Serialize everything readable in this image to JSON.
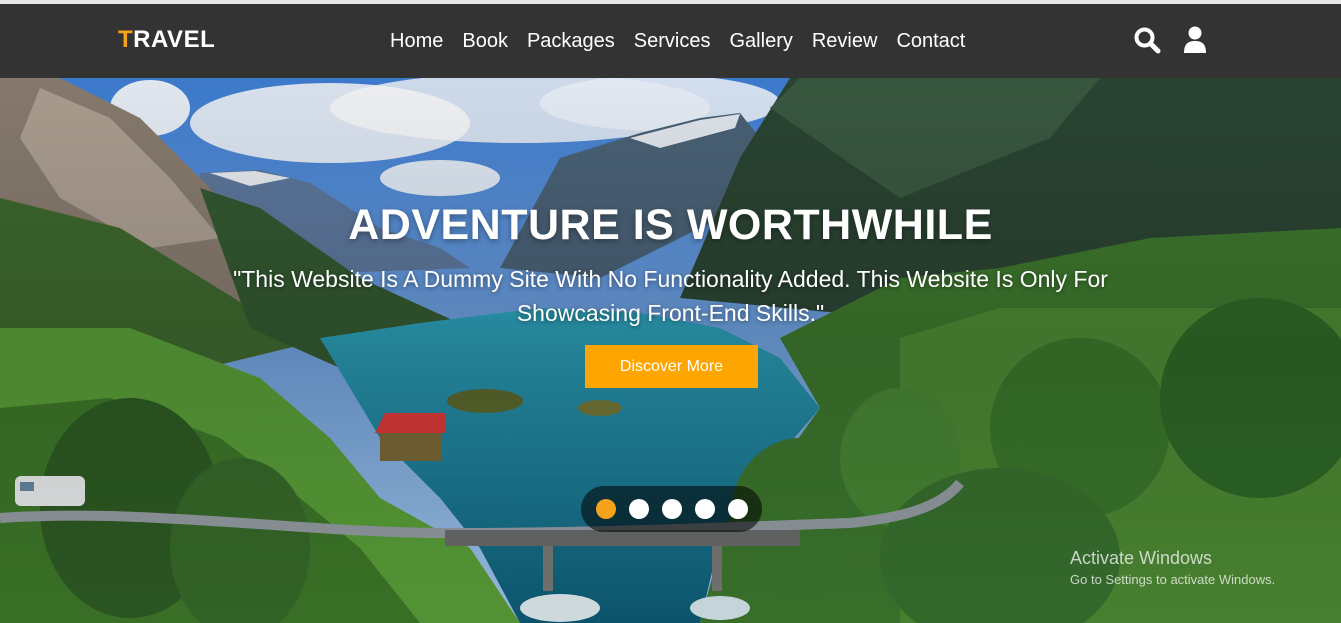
{
  "brand": {
    "initial": "T",
    "rest": "RAVEL",
    "accent_color": "#f7a21b"
  },
  "nav": {
    "links": [
      "Home",
      "Book",
      "Packages",
      "Services",
      "Gallery",
      "Review",
      "Contact"
    ]
  },
  "header_icons": [
    "search-icon",
    "user-icon"
  ],
  "hero": {
    "title": "ADVENTURE IS WORTHWHILE",
    "subtitle": "\"This Website Is A Dummy Site With No Functionality Added. This Website Is Only For Showcasing Front-End Skills.\"",
    "cta_label": "Discover More",
    "cta_color": "#ffa500"
  },
  "slider": {
    "count": 5,
    "active_index": 0
  },
  "os_watermark": {
    "line1": "Activate Windows",
    "line2": "Go to Settings to activate Windows."
  }
}
